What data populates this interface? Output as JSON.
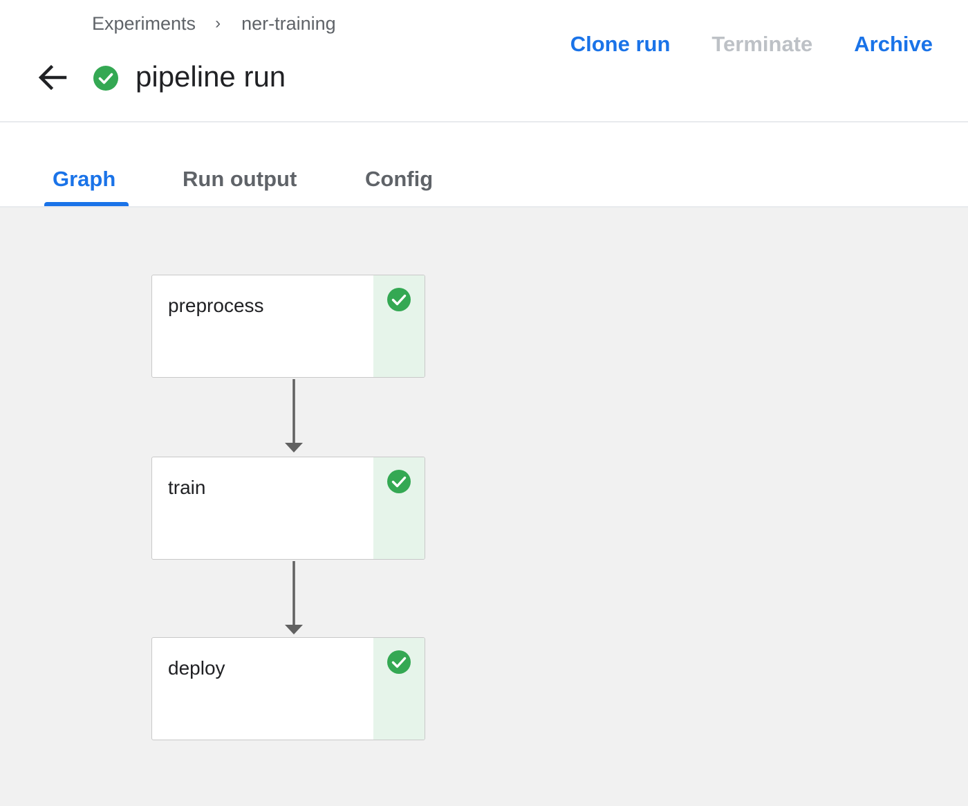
{
  "breadcrumb": {
    "items": [
      "Experiments",
      "ner-training"
    ],
    "separator": "›"
  },
  "header": {
    "title": "pipeline run",
    "status": "succeeded",
    "back_icon": "arrow-back-icon",
    "status_icon": "check-circle-icon"
  },
  "actions": {
    "clone": "Clone run",
    "terminate": "Terminate",
    "archive": "Archive"
  },
  "tabs": [
    {
      "label": "Graph",
      "active": true
    },
    {
      "label": "Run output",
      "active": false
    },
    {
      "label": "Config",
      "active": false
    }
  ],
  "graph": {
    "nodes": [
      {
        "label": "preprocess",
        "status": "succeeded",
        "icon": "check-circle-icon"
      },
      {
        "label": "train",
        "status": "succeeded",
        "icon": "check-circle-icon"
      },
      {
        "label": "deploy",
        "status": "succeeded",
        "icon": "check-circle-icon"
      }
    ],
    "edges": [
      {
        "from": "preprocess",
        "to": "train"
      },
      {
        "from": "train",
        "to": "deploy"
      }
    ]
  },
  "colors": {
    "accent": "#1a73e8",
    "success": "#34a853",
    "success_bg": "#e6f4ea",
    "disabled": "#bdc1c6",
    "canvas_bg": "#f1f1f1"
  }
}
